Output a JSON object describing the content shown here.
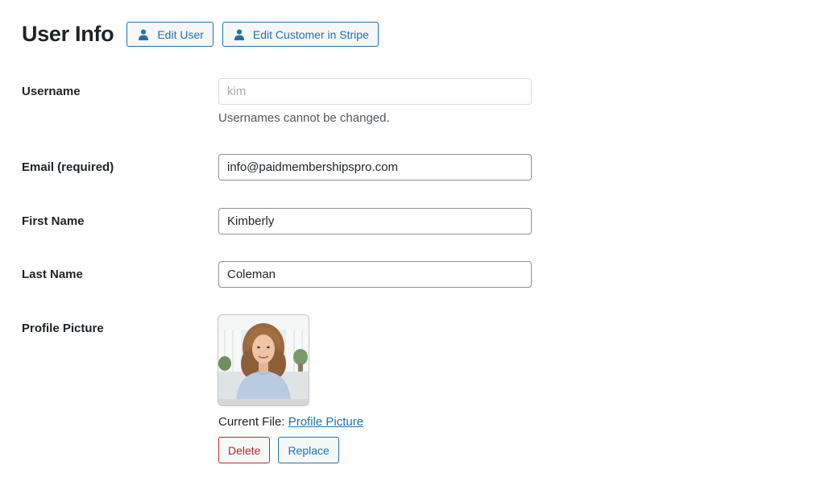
{
  "page": {
    "title": "User Info"
  },
  "header_buttons": [
    {
      "label": "Edit User",
      "icon": "user-icon"
    },
    {
      "label": "Edit Customer in Stripe",
      "icon": "user-icon"
    }
  ],
  "fields": {
    "username": {
      "label": "Username",
      "value": "kim",
      "description": "Usernames cannot be changed."
    },
    "email": {
      "label": "Email (required)",
      "value": "info@paidmembershipspro.com"
    },
    "first_name": {
      "label": "First Name",
      "value": "Kimberly"
    },
    "last_name": {
      "label": "Last Name",
      "value": "Coleman"
    },
    "profile_picture": {
      "label": "Profile Picture",
      "current_file_prefix": "Current File:",
      "current_file_link": "Profile Picture",
      "delete_label": "Delete",
      "replace_label": "Replace"
    }
  },
  "colors": {
    "accent": "#2271b1",
    "danger": "#b32d2e",
    "text": "#1d2327",
    "muted": "#50575e"
  }
}
